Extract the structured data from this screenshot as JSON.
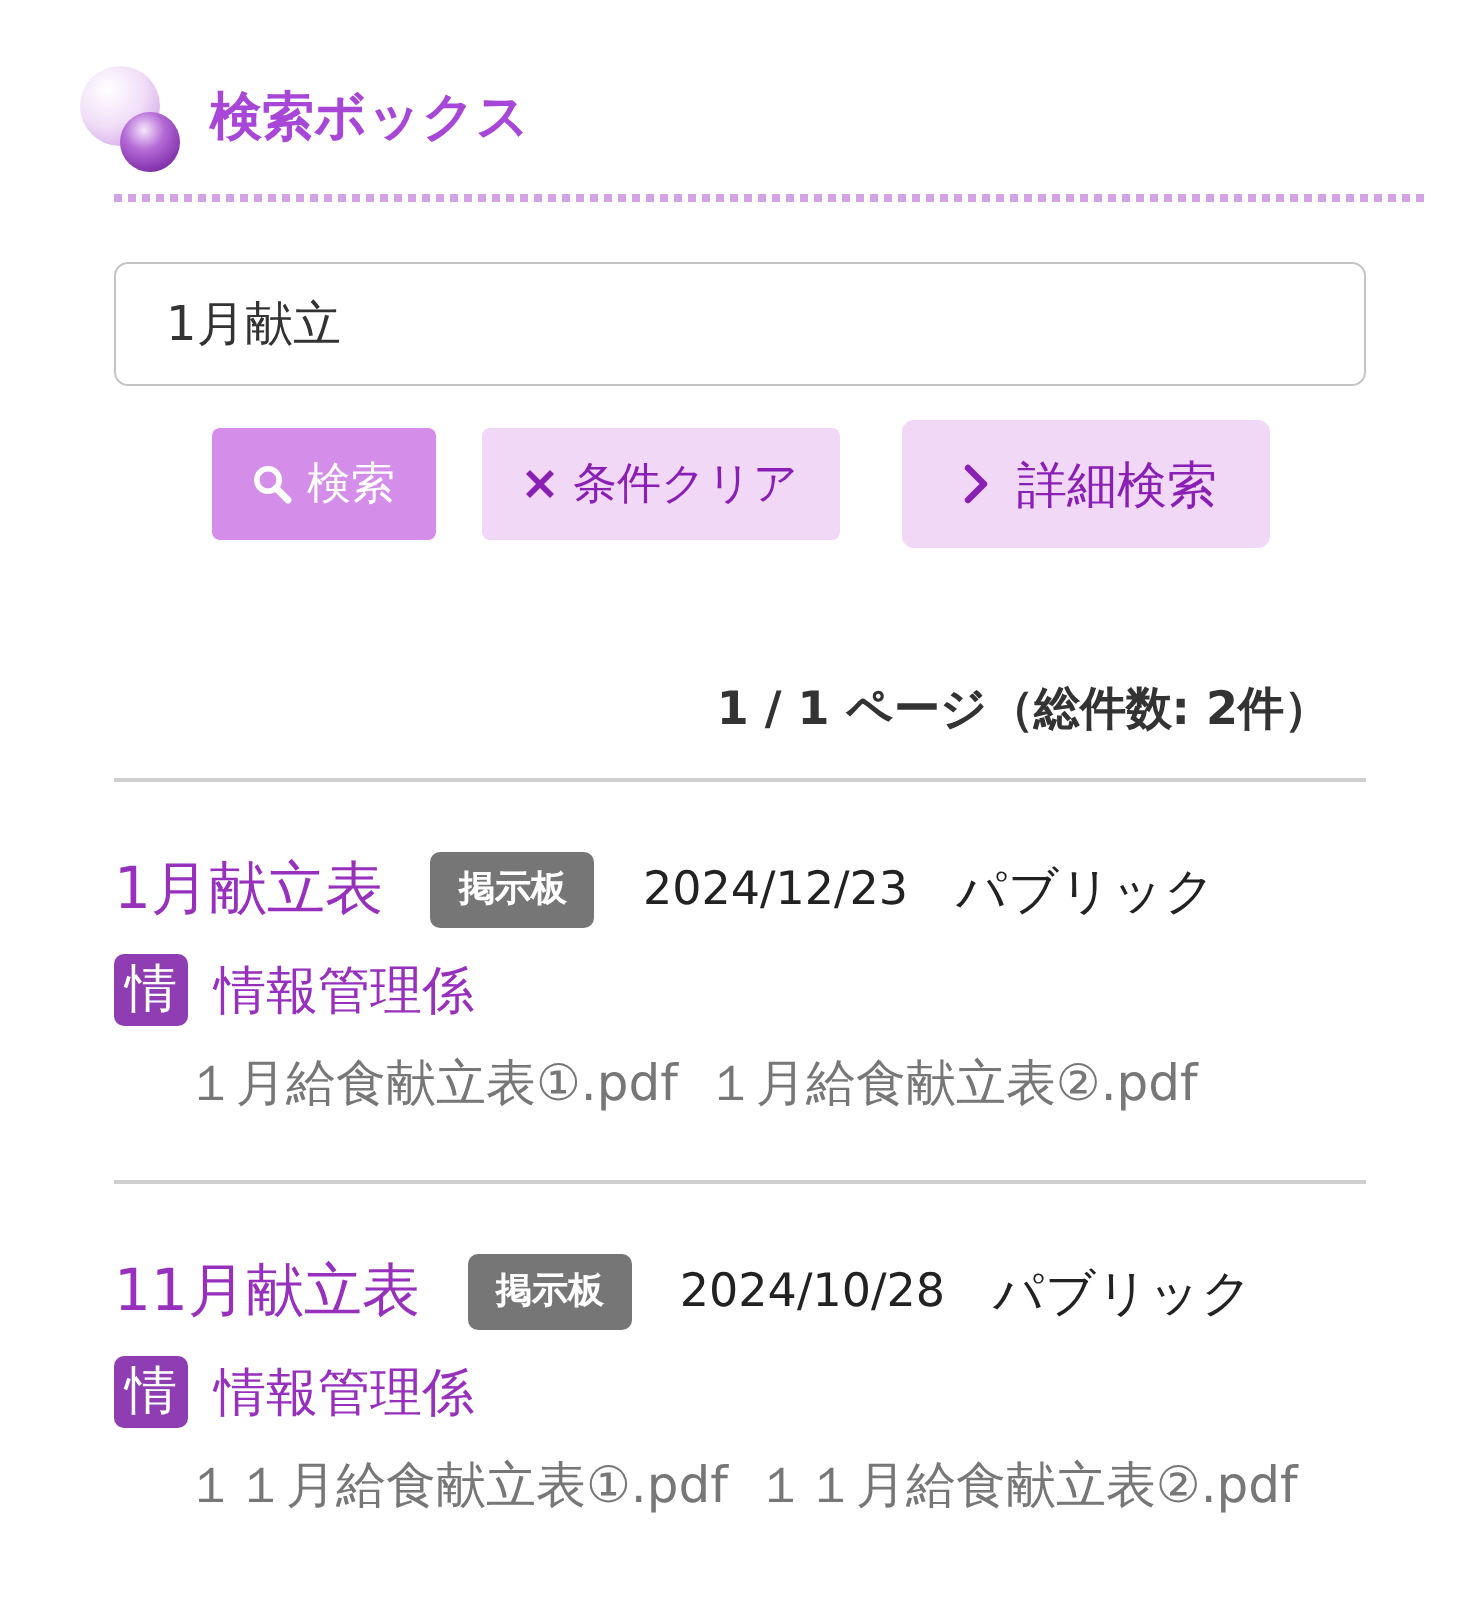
{
  "header": {
    "title": "検索ボックス"
  },
  "search": {
    "value": "1月献立"
  },
  "buttons": [
    {
      "kind": "search",
      "label": "検索"
    },
    {
      "kind": "clear",
      "label": "条件クリア"
    },
    {
      "kind": "advanced",
      "label": "詳細検索"
    }
  ],
  "pagination": {
    "summary": "1 / 1 ページ（総件数: 2件）"
  },
  "results": [
    {
      "title": "1月献立表",
      "category": "掲示板",
      "date": "2024/12/23",
      "visibility": "パブリック",
      "department_icon": "情",
      "department": "情報管理係",
      "attachments": [
        "１月給食献立表①.pdf",
        "１月給食献立表②.pdf"
      ]
    },
    {
      "title": "11月献立表",
      "category": "掲示板",
      "date": "2024/10/28",
      "visibility": "パブリック",
      "department_icon": "情",
      "department": "情報管理係",
      "attachments": [
        "１１月給食献立表①.pdf",
        "１１月給食献立表②.pdf"
      ]
    }
  ]
}
